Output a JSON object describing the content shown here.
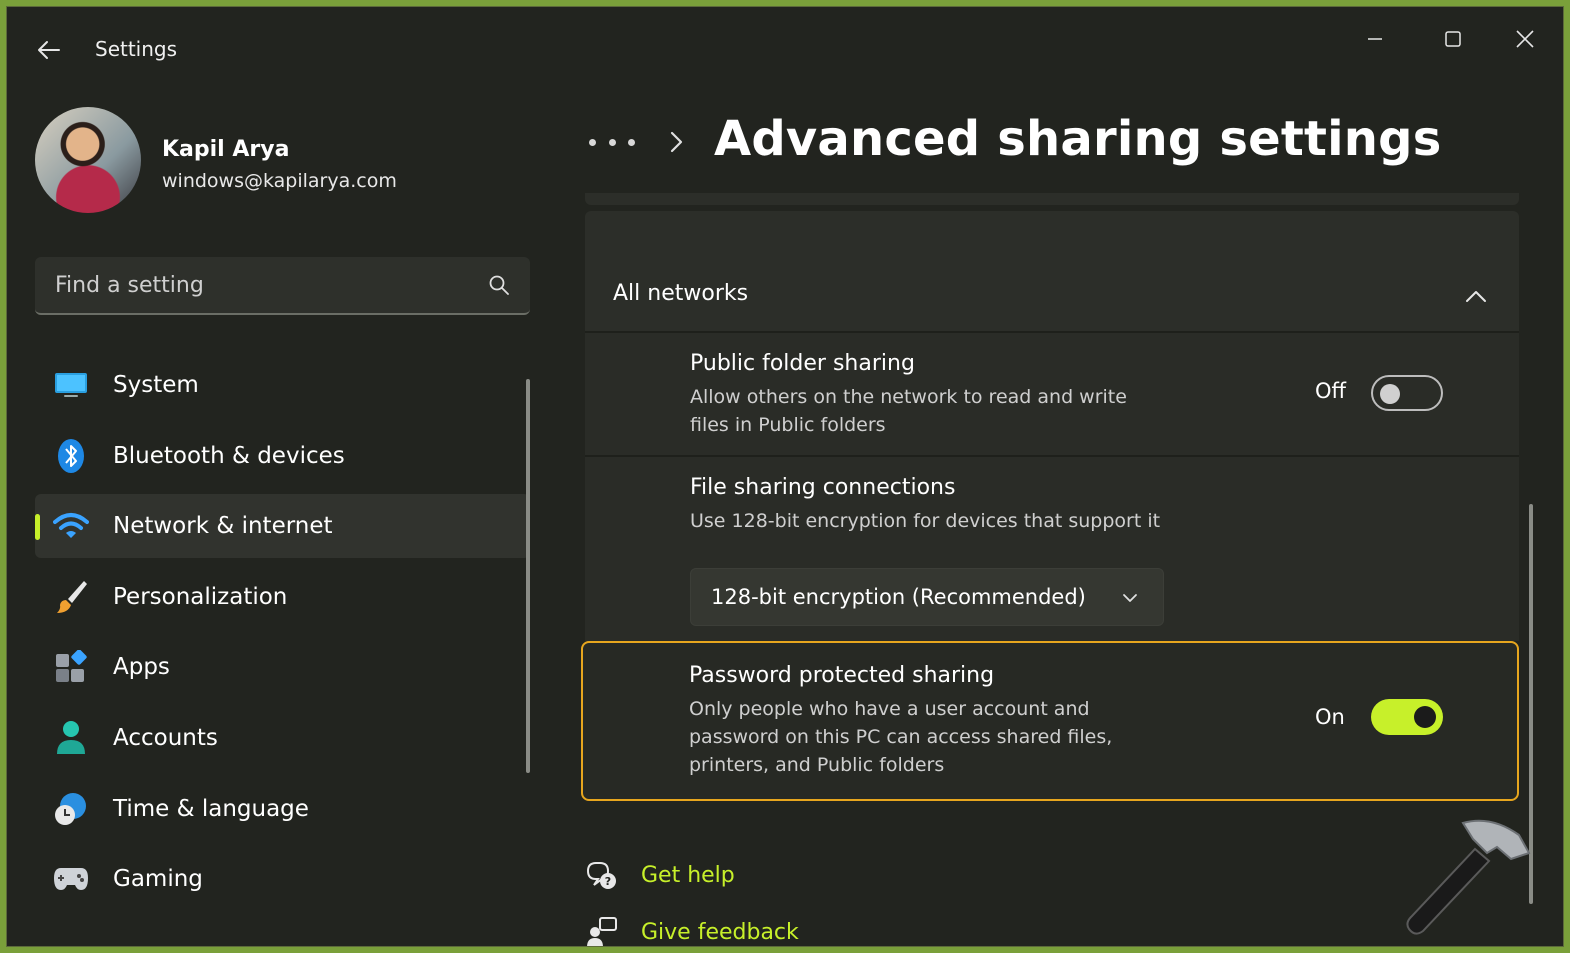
{
  "window": {
    "app_title": "Settings",
    "controls": {
      "minimize": "minimize",
      "maximize": "maximize",
      "close": "close"
    }
  },
  "profile": {
    "name": "Kapil Arya",
    "email": "windows@kapilarya.com"
  },
  "search": {
    "placeholder": "Find a setting",
    "icon": "search-icon"
  },
  "nav": {
    "items": [
      {
        "label": "System",
        "icon": "monitor-icon"
      },
      {
        "label": "Bluetooth & devices",
        "icon": "bluetooth-icon"
      },
      {
        "label": "Network & internet",
        "icon": "wifi-icon",
        "active": true
      },
      {
        "label": "Personalization",
        "icon": "paintbrush-icon"
      },
      {
        "label": "Apps",
        "icon": "apps-icon"
      },
      {
        "label": "Accounts",
        "icon": "person-icon"
      },
      {
        "label": "Time & language",
        "icon": "clock-globe-icon"
      },
      {
        "label": "Gaming",
        "icon": "gamepad-icon"
      }
    ]
  },
  "breadcrumb": {
    "more": "more-icon",
    "separator": "chevron-right-icon"
  },
  "page": {
    "title": "Advanced sharing settings"
  },
  "group": {
    "title": "All networks",
    "expanded": true
  },
  "settings": {
    "public_folder": {
      "title": "Public folder sharing",
      "description": "Allow others on the network to read and write files in Public folders",
      "state_label": "Off",
      "enabled": false
    },
    "file_sharing": {
      "title": "File sharing connections",
      "description": "Use 128-bit encryption for devices that support it",
      "selected": "128-bit encryption (Recommended)"
    },
    "password_protected": {
      "title": "Password protected sharing",
      "description": "Only people who have a user account and password on this PC can access shared files, printers, and Public folders",
      "state_label": "On",
      "enabled": true
    }
  },
  "footer": {
    "help": "Get help",
    "feedback": "Give feedback"
  },
  "colors": {
    "accent": "#c7f02a",
    "highlight_border": "#e7a61e",
    "background": "#22241f",
    "card": "#2a2c27"
  }
}
